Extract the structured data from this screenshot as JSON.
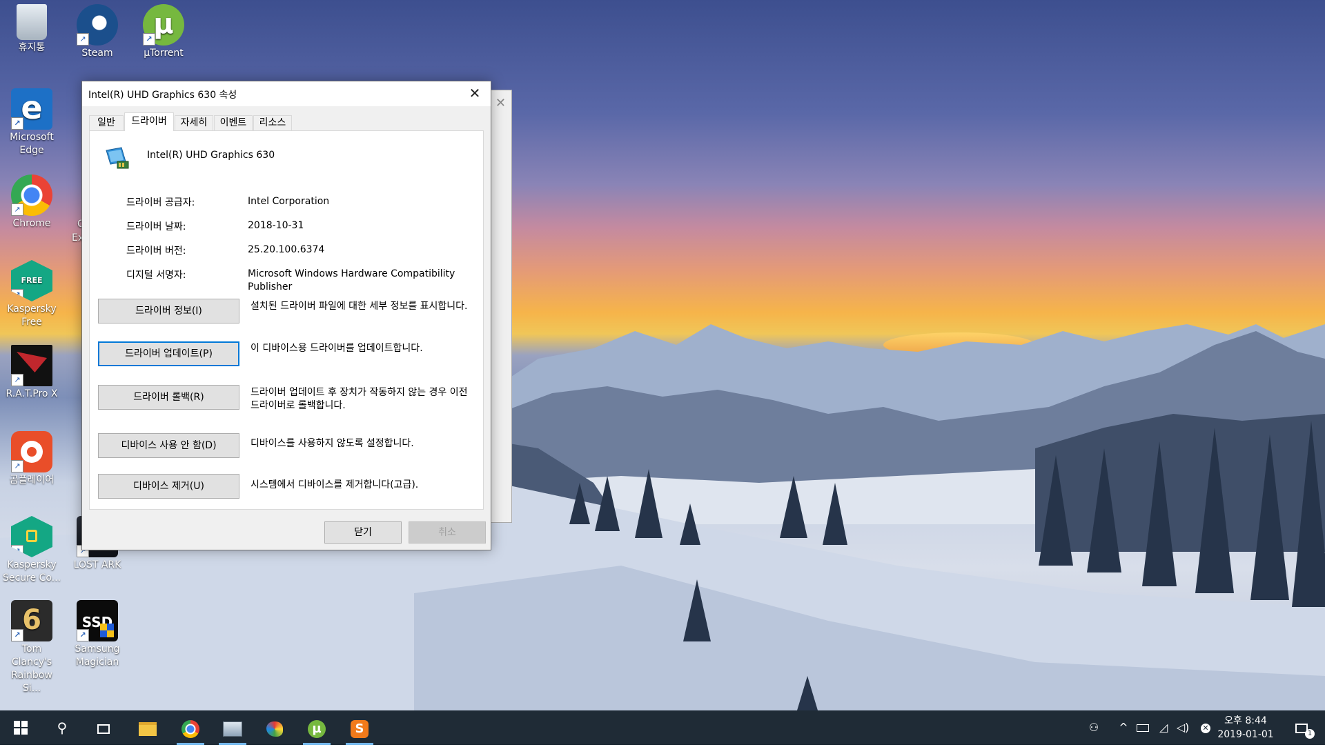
{
  "desktop": {
    "icons": [
      {
        "label": "휴지통",
        "icon": "recycle-bin-icon"
      },
      {
        "label": "Steam",
        "icon": "steam-icon"
      },
      {
        "label": "µTorrent",
        "icon": "utorrent-icon"
      },
      {
        "label": "Microsoft Edge",
        "icon": "edge-icon"
      },
      {
        "label": "Chrome",
        "icon": "chrome-icon"
      },
      {
        "label": "Kaspersky Free",
        "icon": "kaspersky-free-icon"
      },
      {
        "label": "R.A.T.Pro X",
        "icon": "rat-pro-x-icon"
      },
      {
        "label": "곰플레이어",
        "icon": "gom-player-icon"
      },
      {
        "label": "Kaspersky Secure Co...",
        "icon": "kaspersky-secure-icon"
      },
      {
        "label": "LOST ARK",
        "icon": "lost-ark-icon"
      },
      {
        "label": "Tom Clancy's Rainbow Si...",
        "icon": "rainbow-six-icon"
      },
      {
        "label": "Samsung Magician",
        "icon": "samsung-magician-icon"
      }
    ],
    "partial_labels": {
      "c": "C",
      "ex": "Ex"
    }
  },
  "dialog": {
    "title": "Intel(R) UHD Graphics 630 속성",
    "tabs": [
      "일반",
      "드라이버",
      "자세히",
      "이벤트",
      "리소스"
    ],
    "active_tab": "드라이버",
    "device_name": "Intel(R) UHD Graphics 630",
    "info": [
      {
        "label": "드라이버 공급자:",
        "value": "Intel Corporation"
      },
      {
        "label": "드라이버 날짜:",
        "value": "2018-10-31"
      },
      {
        "label": "드라이버 버전:",
        "value": "25.20.100.6374"
      },
      {
        "label": "디지털 서명자:",
        "value": "Microsoft Windows Hardware Compatibility Publisher"
      }
    ],
    "buttons": [
      {
        "label": "드라이버 정보(I)",
        "desc": "설치된 드라이버 파일에 대한 세부 정보를 표시합니다."
      },
      {
        "label": "드라이버 업데이트(P)",
        "desc": "이 디바이스용 드라이버를 업데이트합니다."
      },
      {
        "label": "드라이버 롤백(R)",
        "desc": "드라이버 업데이트 후 장치가 작동하지 않는 경우 이전 드라이버로 롤백합니다."
      },
      {
        "label": "디바이스 사용 안 함(D)",
        "desc": "디바이스를 사용하지 않도록 설정합니다."
      },
      {
        "label": "디바이스 제거(U)",
        "desc": "시스템에서 디바이스를 제거합니다(고급)."
      }
    ],
    "ok_label": "닫기",
    "cancel_label": "취소"
  },
  "taskbar": {
    "clock_time": "오후 8:44",
    "clock_date": "2019-01-01",
    "notification_count": "1"
  },
  "colors": {
    "accent": "#0078d7",
    "taskbar": "#1f2b36"
  }
}
